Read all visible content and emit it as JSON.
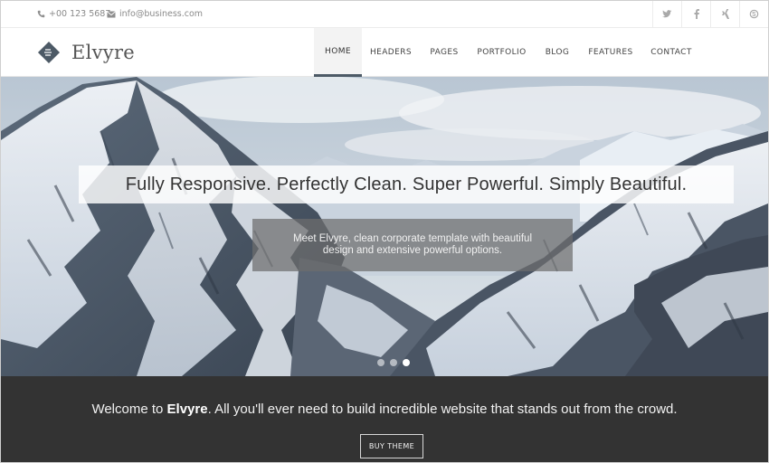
{
  "topbar": {
    "phone": "+00 123 5687",
    "email": "info@business.com",
    "phone_icon": "phone-icon",
    "email_icon": "envelope-icon",
    "social": [
      "twitter-icon",
      "facebook-icon",
      "xing-icon",
      "skype-icon"
    ]
  },
  "brand": {
    "name": "Elvyre",
    "logo_icon": "diamond-logo-icon"
  },
  "nav": {
    "items": [
      {
        "label": "HOME",
        "active": true
      },
      {
        "label": "HEADERS"
      },
      {
        "label": "PAGES"
      },
      {
        "label": "PORTFOLIO"
      },
      {
        "label": "BLOG"
      },
      {
        "label": "FEATURES"
      },
      {
        "label": "CONTACT"
      }
    ]
  },
  "hero": {
    "headline": "Fully Responsive. Perfectly Clean. Super Powerful. Simply Beautiful.",
    "subtext": "Meet Elvyre, clean corporate template with beautiful design and extensive powerful options.",
    "slides": 3,
    "active_slide": 3
  },
  "welcome": {
    "prefix": "Welcome to ",
    "brand": "Elvyre",
    "suffix": ". All you'll ever need to build incredible website that stands out from the crowd.",
    "button": "BUY THEME"
  },
  "colors": {
    "accent": "#4d5a66",
    "band": "#333333"
  }
}
